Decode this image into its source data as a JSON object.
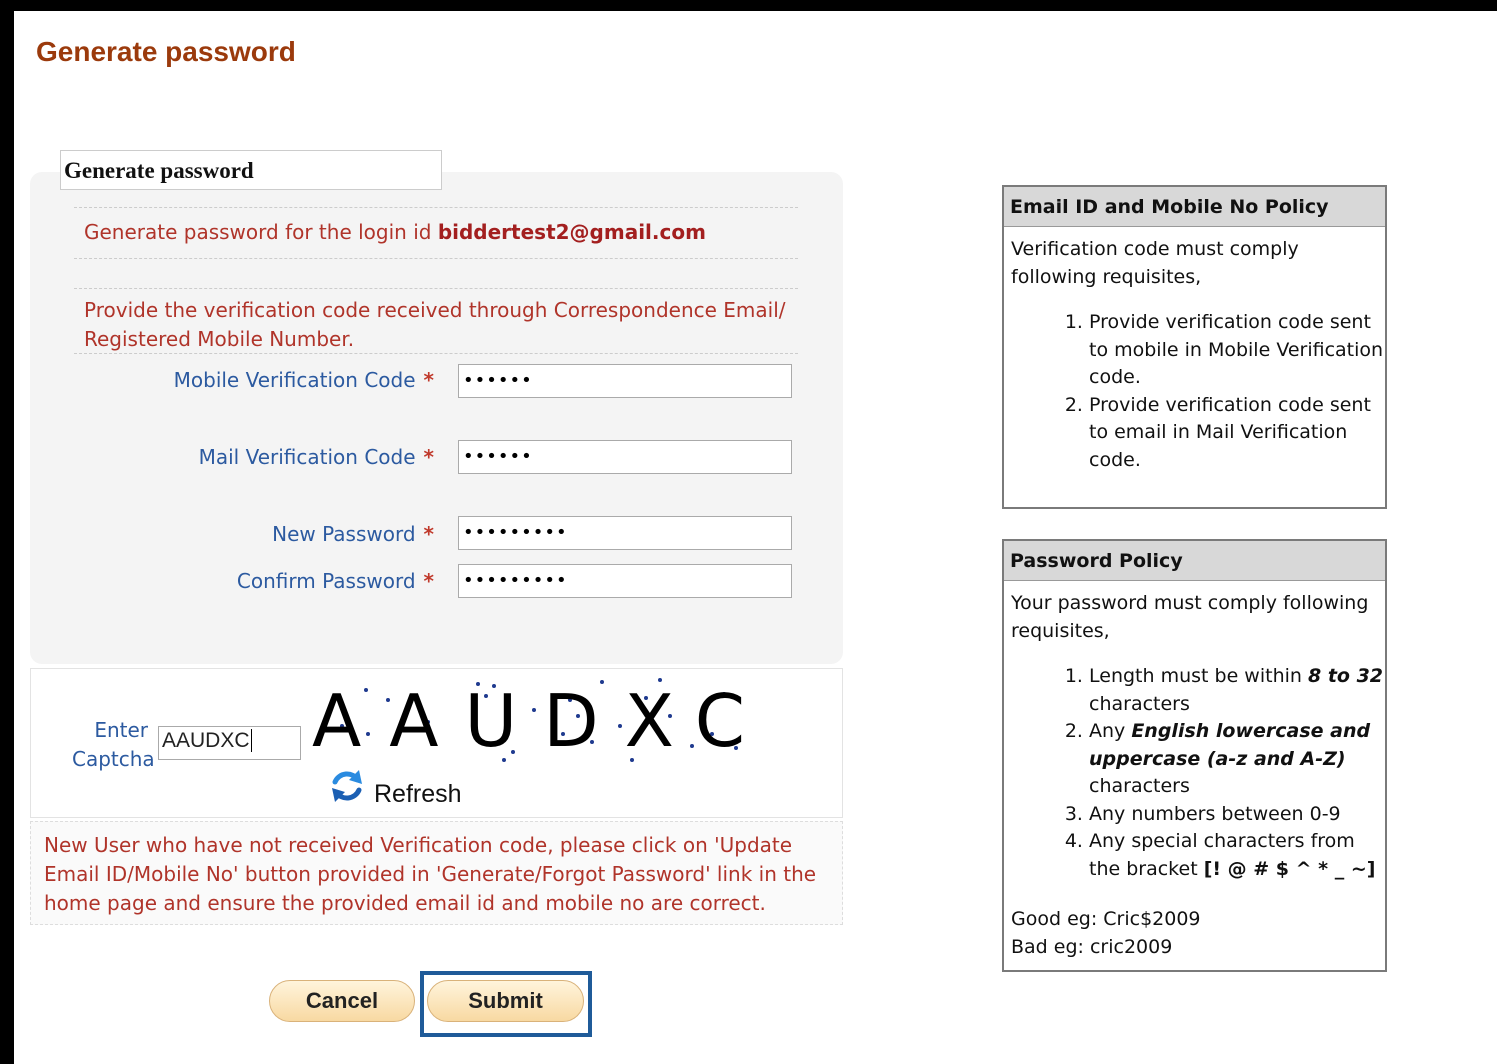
{
  "page_title": "Generate password",
  "form": {
    "tab_title": "Generate password",
    "login_notice_prefix": "Generate password for the login id",
    "login_id": "biddertest2@gmail.com",
    "verification_notice": "Provide the verification code received through Correspondence Email/ Registered Mobile Number.",
    "required_marker": "*",
    "fields": {
      "mobile_code": {
        "label": "Mobile Verification Code",
        "value": "••••••"
      },
      "mail_code": {
        "label": "Mail Verification Code",
        "value": "••••••"
      },
      "new_password": {
        "label": "New Password",
        "value": "•••••••••"
      },
      "confirm_password": {
        "label": "Confirm Password",
        "value": "•••••••••"
      }
    }
  },
  "captcha": {
    "label": "Enter Captcha",
    "input_value": "AAUDXC",
    "image_text": "AAUDXC",
    "refresh_label": "Refresh",
    "refresh_icon": "refresh-icon"
  },
  "new_user_note": "New User who have not received Verification code, please click on 'Update Email ID/Mobile No' button provided in 'Generate/Forgot Password' link in the home page and ensure the provided email id and mobile no are correct.",
  "buttons": {
    "cancel": "Cancel",
    "submit": "Submit"
  },
  "email_policy": {
    "title": "Email ID and Mobile No Policy",
    "intro": "Verification code must comply following requisites,",
    "items": [
      "Provide verification code sent to mobile in Mobile Verification code.",
      "Provide verification code sent to email in Mail Verification code."
    ]
  },
  "password_policy": {
    "title": "Password Policy",
    "intro": "Your password must comply following requisites,",
    "items": [
      {
        "prefix": "Length must be within ",
        "emphasis": "8 to 32",
        "suffix": " characters"
      },
      {
        "prefix": "Any ",
        "emphasis": "English lowercase and uppercase (a-z and A-Z)",
        "suffix": " characters"
      },
      {
        "prefix": "Any numbers between 0-9",
        "emphasis": "",
        "suffix": ""
      },
      {
        "prefix": "Any special characters from the bracket ",
        "emphasis": "[! @ # $ ^ * _ ~]",
        "suffix": ""
      }
    ],
    "good_example": "Good eg: Cric$2009",
    "bad_example": "Bad eg: cric2009"
  },
  "colors": {
    "title": "#9b3a0c",
    "notice_text": "#b0342a",
    "field_label": "#2c5aa0",
    "button_fill": "#f8d9a2",
    "submit_highlight": "#1f5b99"
  }
}
